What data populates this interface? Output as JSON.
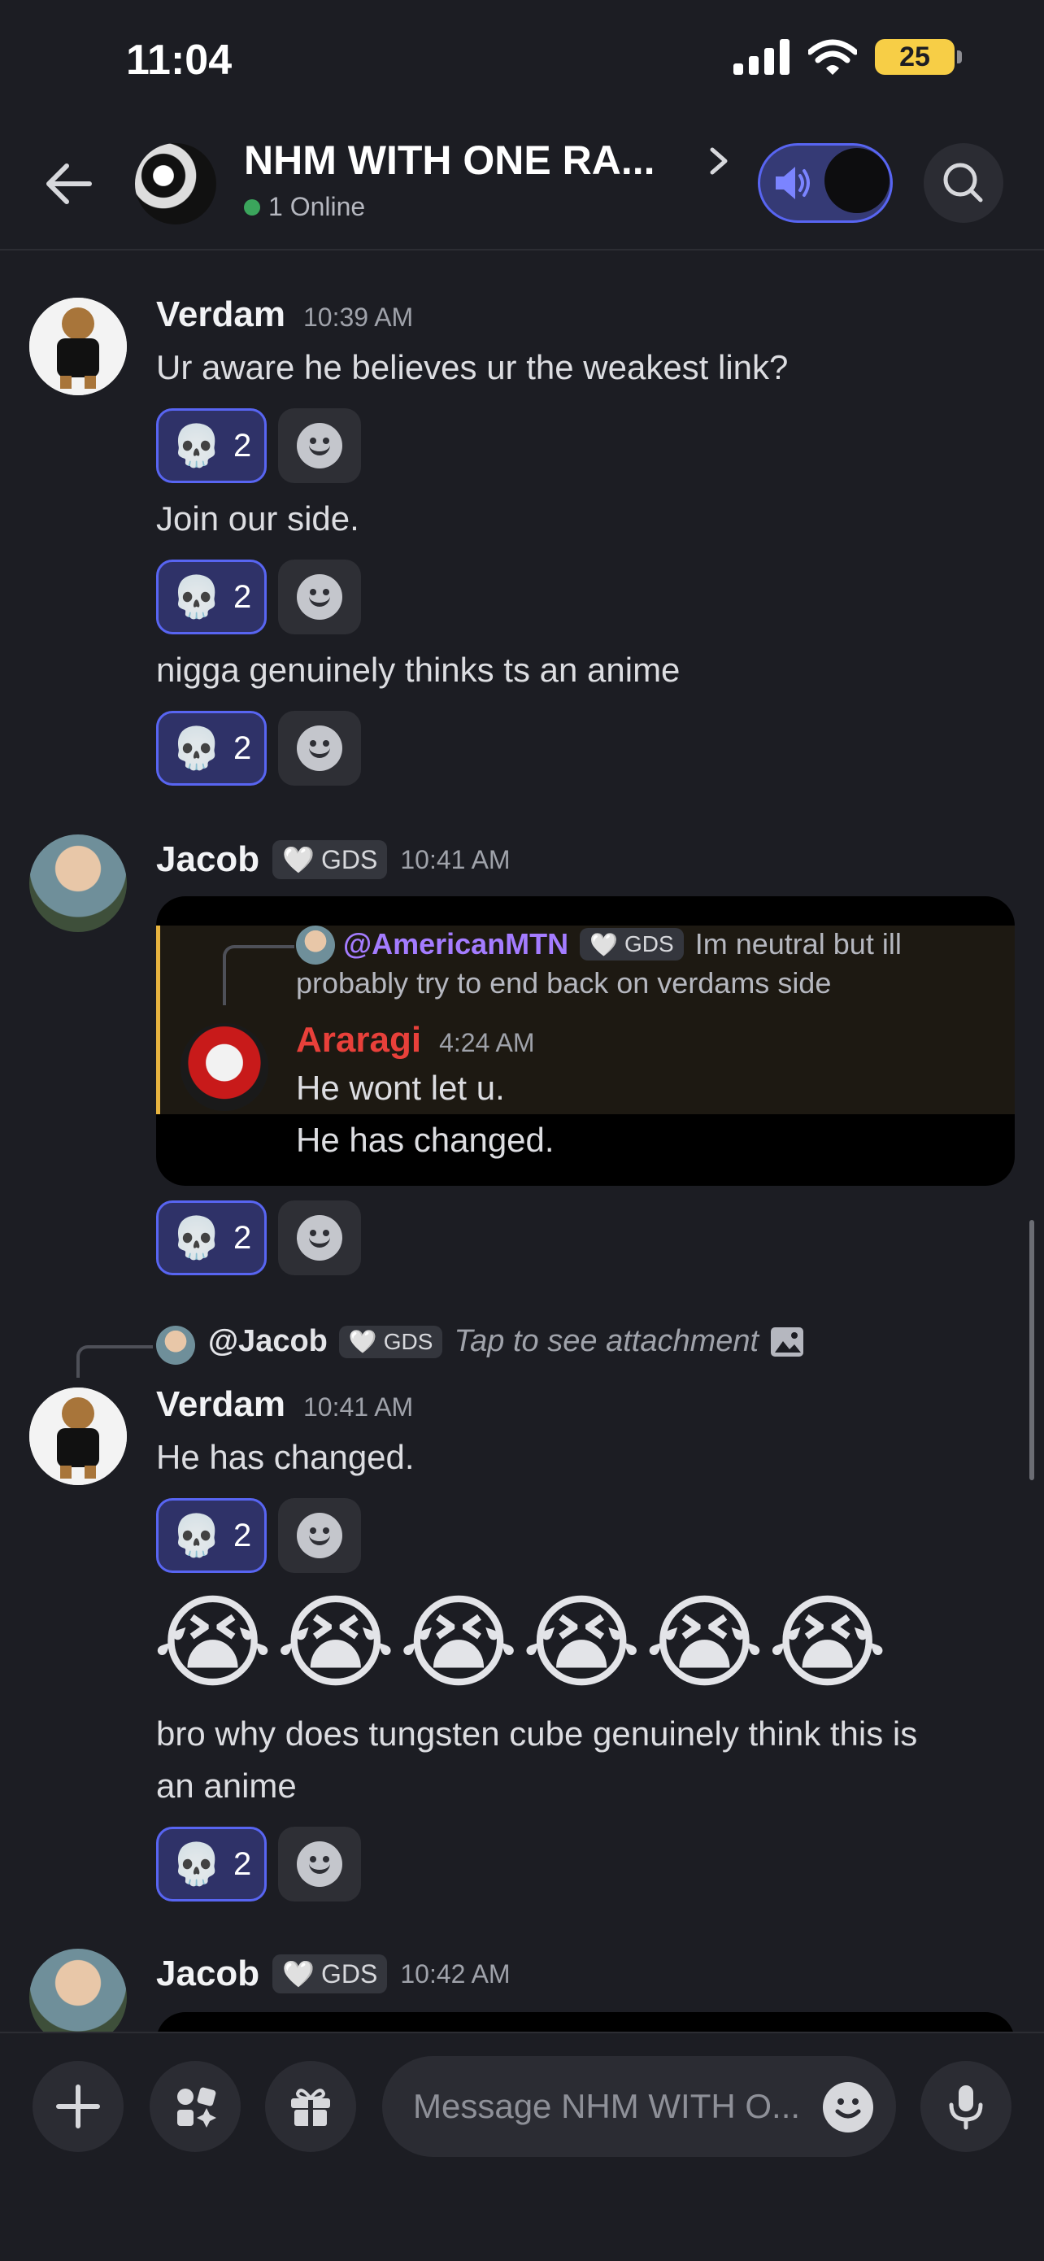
{
  "status_bar": {
    "time": "11:04",
    "battery": "25"
  },
  "header": {
    "channel_title": "NHM WITH ONE RA...",
    "online": "1 Online"
  },
  "messages": [
    {
      "author": "Verdam",
      "time": "10:39 AM",
      "lines": [
        {
          "text": "Ur aware he believes ur the weakest link?",
          "reaction": {
            "emoji": "💀",
            "count": "2"
          }
        },
        {
          "text": "Join our side.",
          "reaction": {
            "emoji": "💀",
            "count": "2"
          }
        },
        {
          "text": "nigga genuinely thinks ts an anime",
          "reaction": {
            "emoji": "💀",
            "count": "2"
          }
        }
      ]
    },
    {
      "author": "Jacob",
      "tag": "GDS",
      "time": "10:41 AM",
      "forward": {
        "reply_mention": "@AmericanMTN",
        "reply_tag": "GDS",
        "reply_text_1": "Im neutral but ill",
        "reply_text_2": "probably try to end back on verdams side",
        "author": "Araragi",
        "time": "4:24 AM",
        "lines": [
          "He wont let u.",
          "He has changed."
        ]
      },
      "reaction": {
        "emoji": "💀",
        "count": "2"
      }
    },
    {
      "reply_mention": "@Jacob",
      "reply_tag": "GDS",
      "reply_text": "Tap to see attachment",
      "author": "Verdam",
      "time": "10:41 AM",
      "line_1": "He has changed.",
      "reaction_1": {
        "emoji": "💀",
        "count": "2"
      },
      "emojis": "😭😭😭😭😭😭",
      "line_2a": "bro why does tungsten cube genuinely think this is",
      "line_2b": "an anime",
      "reaction_2": {
        "emoji": "💀",
        "count": "2"
      }
    },
    {
      "author": "Jacob",
      "tag": "GDS",
      "time": "10:42 AM"
    }
  ],
  "composer": {
    "placeholder": "Message NHM WITH O..."
  },
  "colors": {
    "background": "#1c1d23",
    "accent": "#5865f2",
    "quote_bar": "#e8b440",
    "mention": "#a47cff",
    "online": "#3ba55c",
    "araragi": "#e8403a"
  }
}
